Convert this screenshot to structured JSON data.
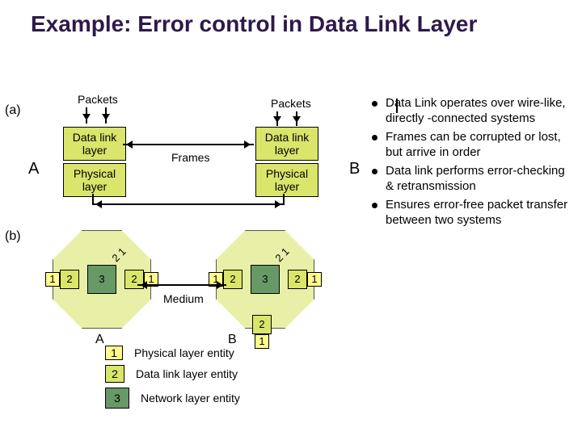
{
  "title": "Example: Error control in Data Link Layer",
  "a": {
    "marker": "(a)",
    "A": "A",
    "B": "B",
    "packets": "Packets",
    "dll": "Data link layer",
    "phy": "Physical layer",
    "frames": "Frames"
  },
  "b": {
    "marker": "(b)",
    "one": "1",
    "two": "2",
    "three": "3",
    "tilt": "2 1",
    "medium": "Medium",
    "A": "A",
    "B": "B",
    "stackTop": "2",
    "stackBot": "1"
  },
  "legend": {
    "l1": "Physical layer entity",
    "l2": "Data link layer entity",
    "l3": "Network layer entity"
  },
  "bullets": [
    "Data Link operates over wire-like, directly -connected systems",
    "Frames can be corrupted or lost, but arrive in order",
    "Data link performs error-checking & retransmission",
    "Ensures error-free packet transfer between two systems"
  ]
}
